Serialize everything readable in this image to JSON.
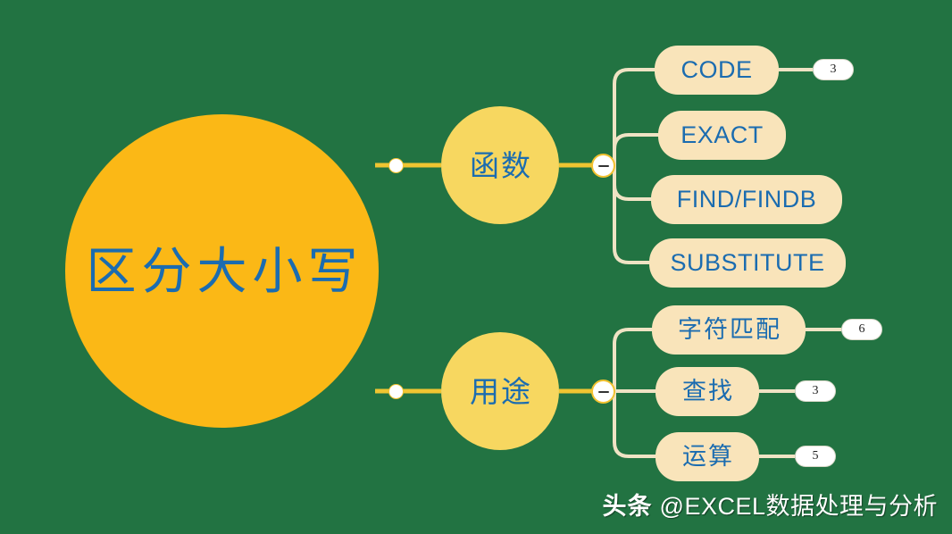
{
  "colors": {
    "background": "#227342",
    "root_fill": "#FBB816",
    "branch_fill": "#F7D760",
    "leaf_fill": "#F9E4BA",
    "text_blue": "#1B6CB0",
    "wire_yellow": "#EFC531",
    "wire_cream": "#EFE3C4",
    "badge_fill": "#FFFFFF",
    "badge_text": "#222222",
    "watermark_text": "#FFFFFF"
  },
  "mindmap": {
    "root": {
      "label": "区分大小写"
    },
    "branches": [
      {
        "label": "函数",
        "toggle": "collapse-minus",
        "children": [
          {
            "label": "CODE",
            "badge": "3"
          },
          {
            "label": "EXACT",
            "badge": null
          },
          {
            "label": "FIND/FINDB",
            "badge": null
          },
          {
            "label": "SUBSTITUTE",
            "badge": null
          }
        ]
      },
      {
        "label": "用途",
        "toggle": "collapse-minus",
        "children": [
          {
            "label": "字符匹配",
            "badge": "6"
          },
          {
            "label": "查找",
            "badge": "3"
          },
          {
            "label": "运算",
            "badge": "5"
          }
        ]
      }
    ]
  },
  "watermark": {
    "brand": "头条",
    "handle": "@EXCEL数据处理与分析"
  }
}
